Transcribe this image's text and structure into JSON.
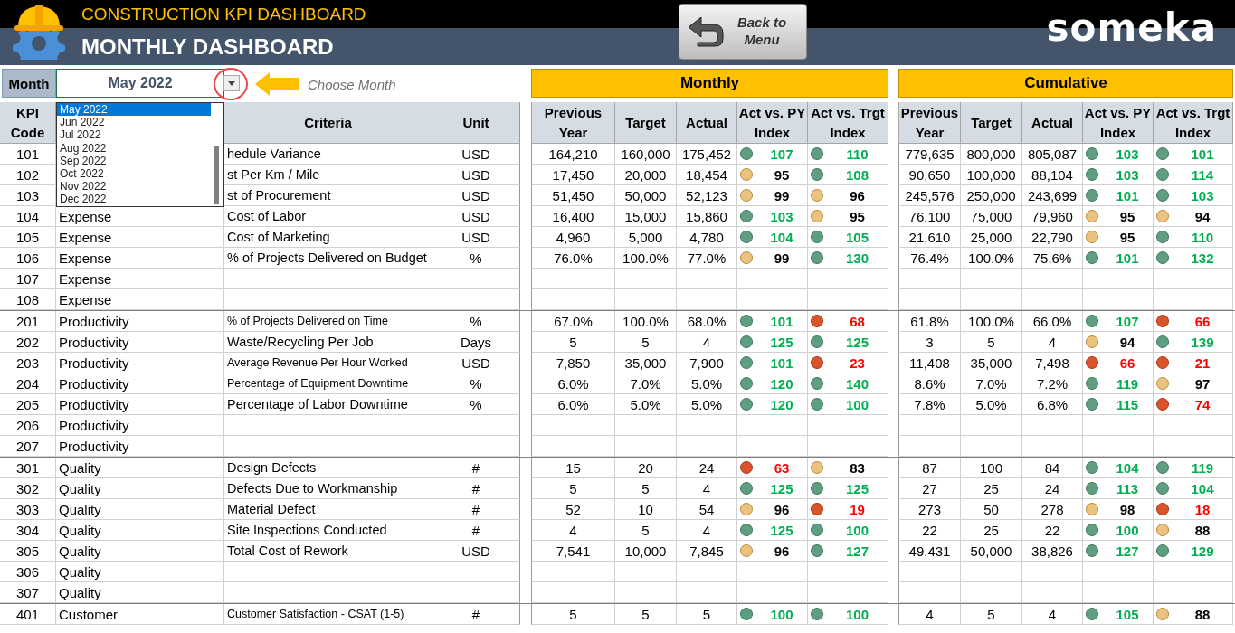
{
  "header": {
    "title": "CONSTRUCTION KPI DASHBOARD",
    "subtitle": "MONTHLY DASHBOARD",
    "back_button": "Back to Menu",
    "logo": "someka"
  },
  "month_picker": {
    "label": "Month",
    "value": "May 2022",
    "hint": "Choose Month",
    "options": [
      {
        "label": "May 2022",
        "selected": true
      },
      {
        "label": "Jun 2022",
        "selected": false
      },
      {
        "label": "Jul 2022",
        "selected": false
      },
      {
        "label": "Aug 2022",
        "selected": false
      },
      {
        "label": "Sep 2022",
        "selected": false
      },
      {
        "label": "Oct 2022",
        "selected": false
      },
      {
        "label": "Nov 2022",
        "selected": false
      },
      {
        "label": "Dec 2022",
        "selected": false
      }
    ]
  },
  "sections": [
    {
      "title": "Monthly",
      "columns": [
        "Previous Year",
        "Target",
        "Actual",
        "Act vs. PY Index",
        "Act vs. Trgt Index"
      ]
    },
    {
      "title": "Cumulative",
      "columns": [
        "Previous Year",
        "Target",
        "Actual",
        "Act vs. PY Index",
        "Act vs. Trgt Index"
      ]
    }
  ],
  "columns": {
    "code": "KPI Code",
    "criteria": "Criteria",
    "unit": "Unit"
  },
  "groups": [
    {
      "rows": [
        {
          "code": "101",
          "criteria": "hedule Variance",
          "unit": "USD",
          "monthly": {
            "previous_year": "164,210",
            "target": "160,000",
            "actual": "175,452",
            "vs_py": {
              "value": "107",
              "color": "#5f9e80"
            },
            "vs_target": {
              "value": "110",
              "color": "#5f9e80"
            }
          },
          "cumulative": {
            "previous_year": "779,635",
            "target": "800,000",
            "actual": "805,087",
            "vs_py": {
              "value": "103",
              "color": "#5f9e80"
            },
            "vs_target": {
              "value": "101",
              "color": "#5f9e80"
            }
          }
        },
        {
          "code": "102",
          "criteria": "st Per Km / Mile",
          "unit": "USD",
          "monthly": {
            "previous_year": "17,450",
            "target": "20,000",
            "actual": "18,454",
            "vs_py": {
              "value": "95",
              "color": "#ebc27f"
            },
            "vs_target": {
              "value": "108",
              "color": "#5f9e80"
            }
          },
          "cumulative": {
            "previous_year": "90,650",
            "target": "100,000",
            "actual": "88,104",
            "vs_py": {
              "value": "103",
              "color": "#5f9e80"
            },
            "vs_target": {
              "value": "114",
              "color": "#5f9e80"
            }
          }
        },
        {
          "code": "103",
          "criteria": "st of Procurement",
          "unit": "USD",
          "monthly": {
            "previous_year": "51,450",
            "target": "50,000",
            "actual": "52,123",
            "vs_py": {
              "value": "99",
              "color": "#ebc27f"
            },
            "vs_target": {
              "value": "96",
              "color": "#ebc27f"
            }
          },
          "cumulative": {
            "previous_year": "245,576",
            "target": "250,000",
            "actual": "243,699",
            "vs_py": {
              "value": "101",
              "color": "#5f9e80"
            },
            "vs_target": {
              "value": "103",
              "color": "#5f9e80"
            }
          }
        },
        {
          "code": "104",
          "category": "Expense",
          "criteria": "Cost of Labor",
          "unit": "USD",
          "monthly": {
            "previous_year": "16,400",
            "target": "15,000",
            "actual": "15,860",
            "vs_py": {
              "value": "103",
              "color": "#5f9e80"
            },
            "vs_target": {
              "value": "95",
              "color": "#ebc27f"
            }
          },
          "cumulative": {
            "previous_year": "76,100",
            "target": "75,000",
            "actual": "79,960",
            "vs_py": {
              "value": "95",
              "color": "#ebc27f"
            },
            "vs_target": {
              "value": "94",
              "color": "#ebc27f"
            }
          }
        },
        {
          "code": "105",
          "category": "Expense",
          "criteria": "Cost of Marketing",
          "unit": "USD",
          "monthly": {
            "previous_year": "4,960",
            "target": "5,000",
            "actual": "4,780",
            "vs_py": {
              "value": "104",
              "color": "#5f9e80"
            },
            "vs_target": {
              "value": "105",
              "color": "#5f9e80"
            }
          },
          "cumulative": {
            "previous_year": "21,610",
            "target": "25,000",
            "actual": "22,790",
            "vs_py": {
              "value": "95",
              "color": "#ebc27f"
            },
            "vs_target": {
              "value": "110",
              "color": "#5f9e80"
            }
          }
        },
        {
          "code": "106",
          "category": "Expense",
          "criteria": "% of Projects Delivered on Budget",
          "unit": "%",
          "monthly": {
            "previous_year": "76.0%",
            "target": "100.0%",
            "actual": "77.0%",
            "vs_py": {
              "value": "99",
              "color": "#ebc27f"
            },
            "vs_target": {
              "value": "130",
              "color": "#5f9e80"
            }
          },
          "cumulative": {
            "previous_year": "76.4%",
            "target": "100.0%",
            "actual": "75.6%",
            "vs_py": {
              "value": "101",
              "color": "#5f9e80"
            },
            "vs_target": {
              "value": "132",
              "color": "#5f9e80"
            }
          }
        },
        {
          "code": "107",
          "category": "Expense"
        },
        {
          "code": "108",
          "category": "Expense"
        }
      ]
    },
    {
      "rows": [
        {
          "code": "201",
          "category": "Productivity",
          "criteria": "% of Projects Delivered on Time",
          "unit": "%",
          "monthly": {
            "previous_year": "67.0%",
            "target": "100.0%",
            "actual": "68.0%",
            "vs_py": {
              "value": "101",
              "color": "#5f9e80"
            },
            "vs_target": {
              "value": "68",
              "color": "#d9532b"
            }
          },
          "cumulative": {
            "previous_year": "61.8%",
            "target": "100.0%",
            "actual": "66.0%",
            "vs_py": {
              "value": "107",
              "color": "#5f9e80"
            },
            "vs_target": {
              "value": "66",
              "color": "#d9532b"
            }
          }
        },
        {
          "code": "202",
          "category": "Productivity",
          "criteria": "Waste/Recycling Per Job",
          "unit": "Days",
          "monthly": {
            "previous_year": "5",
            "target": "5",
            "actual": "4",
            "vs_py": {
              "value": "125",
              "color": "#5f9e80"
            },
            "vs_target": {
              "value": "125",
              "color": "#5f9e80"
            }
          },
          "cumulative": {
            "previous_year": "3",
            "target": "5",
            "actual": "4",
            "vs_py": {
              "value": "94",
              "color": "#ebc27f"
            },
            "vs_target": {
              "value": "139",
              "color": "#5f9e80"
            }
          }
        },
        {
          "code": "203",
          "category": "Productivity",
          "criteria": "Average Revenue Per Hour Worked",
          "unit": "USD",
          "monthly": {
            "previous_year": "7,850",
            "target": "35,000",
            "actual": "7,900",
            "vs_py": {
              "value": "101",
              "color": "#5f9e80"
            },
            "vs_target": {
              "value": "23",
              "color": "#d9532b"
            }
          },
          "cumulative": {
            "previous_year": "11,408",
            "target": "35,000",
            "actual": "7,498",
            "vs_py": {
              "value": "66",
              "color": "#d9532b"
            },
            "vs_target": {
              "value": "21",
              "color": "#d9532b"
            }
          }
        },
        {
          "code": "204",
          "category": "Productivity",
          "criteria": "Percentage of Equipment Downtime",
          "unit": "%",
          "monthly": {
            "previous_year": "6.0%",
            "target": "7.0%",
            "actual": "5.0%",
            "vs_py": {
              "value": "120",
              "color": "#5f9e80"
            },
            "vs_target": {
              "value": "140",
              "color": "#5f9e80"
            }
          },
          "cumulative": {
            "previous_year": "8.6%",
            "target": "7.0%",
            "actual": "7.2%",
            "vs_py": {
              "value": "119",
              "color": "#5f9e80"
            },
            "vs_target": {
              "value": "97",
              "color": "#ebc27f"
            }
          }
        },
        {
          "code": "205",
          "category": "Productivity",
          "criteria": "Percentage of Labor Downtime",
          "unit": "%",
          "monthly": {
            "previous_year": "6.0%",
            "target": "5.0%",
            "actual": "5.0%",
            "vs_py": {
              "value": "120",
              "color": "#5f9e80"
            },
            "vs_target": {
              "value": "100",
              "color": "#5f9e80"
            }
          },
          "cumulative": {
            "previous_year": "7.8%",
            "target": "5.0%",
            "actual": "6.8%",
            "vs_py": {
              "value": "115",
              "color": "#5f9e80"
            },
            "vs_target": {
              "value": "74",
              "color": "#d9532b"
            }
          }
        },
        {
          "code": "206",
          "category": "Productivity"
        },
        {
          "code": "207",
          "category": "Productivity"
        }
      ]
    },
    {
      "rows": [
        {
          "code": "301",
          "category": "Quality",
          "criteria": "Design Defects",
          "unit": "#",
          "monthly": {
            "previous_year": "15",
            "target": "20",
            "actual": "24",
            "vs_py": {
              "value": "63",
              "color": "#d9532b"
            },
            "vs_target": {
              "value": "83",
              "color": "#ebc27f"
            }
          },
          "cumulative": {
            "previous_year": "87",
            "target": "100",
            "actual": "84",
            "vs_py": {
              "value": "104",
              "color": "#5f9e80"
            },
            "vs_target": {
              "value": "119",
              "color": "#5f9e80"
            }
          }
        },
        {
          "code": "302",
          "category": "Quality",
          "criteria": "Defects Due to Workmanship",
          "unit": "#",
          "monthly": {
            "previous_year": "5",
            "target": "5",
            "actual": "4",
            "vs_py": {
              "value": "125",
              "color": "#5f9e80"
            },
            "vs_target": {
              "value": "125",
              "color": "#5f9e80"
            }
          },
          "cumulative": {
            "previous_year": "27",
            "target": "25",
            "actual": "24",
            "vs_py": {
              "value": "113",
              "color": "#5f9e80"
            },
            "vs_target": {
              "value": "104",
              "color": "#5f9e80"
            }
          }
        },
        {
          "code": "303",
          "category": "Quality",
          "criteria": "Material Defect",
          "unit": "#",
          "monthly": {
            "previous_year": "52",
            "target": "10",
            "actual": "54",
            "vs_py": {
              "value": "96",
              "color": "#ebc27f"
            },
            "vs_target": {
              "value": "19",
              "color": "#d9532b"
            }
          },
          "cumulative": {
            "previous_year": "273",
            "target": "50",
            "actual": "278",
            "vs_py": {
              "value": "98",
              "color": "#ebc27f"
            },
            "vs_target": {
              "value": "18",
              "color": "#d9532b"
            }
          }
        },
        {
          "code": "304",
          "category": "Quality",
          "criteria": "Site Inspections Conducted",
          "unit": "#",
          "monthly": {
            "previous_year": "4",
            "target": "5",
            "actual": "4",
            "vs_py": {
              "value": "125",
              "color": "#5f9e80"
            },
            "vs_target": {
              "value": "100",
              "color": "#5f9e80"
            }
          },
          "cumulative": {
            "previous_year": "22",
            "target": "25",
            "actual": "22",
            "vs_py": {
              "value": "100",
              "color": "#5f9e80"
            },
            "vs_target": {
              "value": "88",
              "color": "#ebc27f"
            }
          }
        },
        {
          "code": "305",
          "category": "Quality",
          "criteria": "Total Cost of Rework",
          "unit": "USD",
          "monthly": {
            "previous_year": "7,541",
            "target": "10,000",
            "actual": "7,845",
            "vs_py": {
              "value": "96",
              "color": "#ebc27f"
            },
            "vs_target": {
              "value": "127",
              "color": "#5f9e80"
            }
          },
          "cumulative": {
            "previous_year": "49,431",
            "target": "50,000",
            "actual": "38,826",
            "vs_py": {
              "value": "127",
              "color": "#5f9e80"
            },
            "vs_target": {
              "value": "129",
              "color": "#5f9e80"
            }
          }
        },
        {
          "code": "306",
          "category": "Quality"
        },
        {
          "code": "307",
          "category": "Quality"
        }
      ]
    },
    {
      "rows": [
        {
          "code": "401",
          "category": "Customer",
          "criteria": "Customer Satisfaction - CSAT (1-5)",
          "unit": "#",
          "monthly": {
            "previous_year": "5",
            "target": "5",
            "actual": "5",
            "vs_py": {
              "value": "100",
              "color": "#5f9e80"
            },
            "vs_target": {
              "value": "100",
              "color": "#5f9e80"
            }
          },
          "cumulative": {
            "previous_year": "4",
            "target": "5",
            "actual": "4",
            "vs_py": {
              "value": "105",
              "color": "#5f9e80"
            },
            "vs_target": {
              "value": "88",
              "color": "#ebc27f"
            }
          }
        }
      ]
    }
  ]
}
